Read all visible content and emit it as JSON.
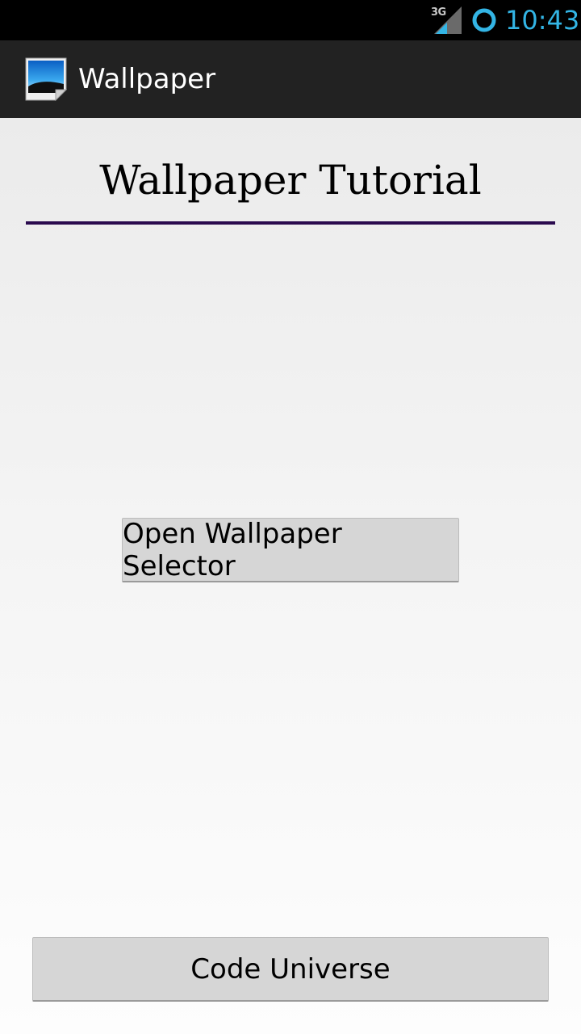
{
  "status_bar": {
    "network_type": "3G",
    "time": "10:43",
    "accent_color": "#33b5e5"
  },
  "action_bar": {
    "app_icon": "wallpaper-image-icon",
    "title": "Wallpaper"
  },
  "main": {
    "heading": "Wallpaper Tutorial",
    "rule_color": "#2a0a4e",
    "open_selector_label": "Open Wallpaper Selector",
    "code_universe_label": "Code Universe"
  }
}
